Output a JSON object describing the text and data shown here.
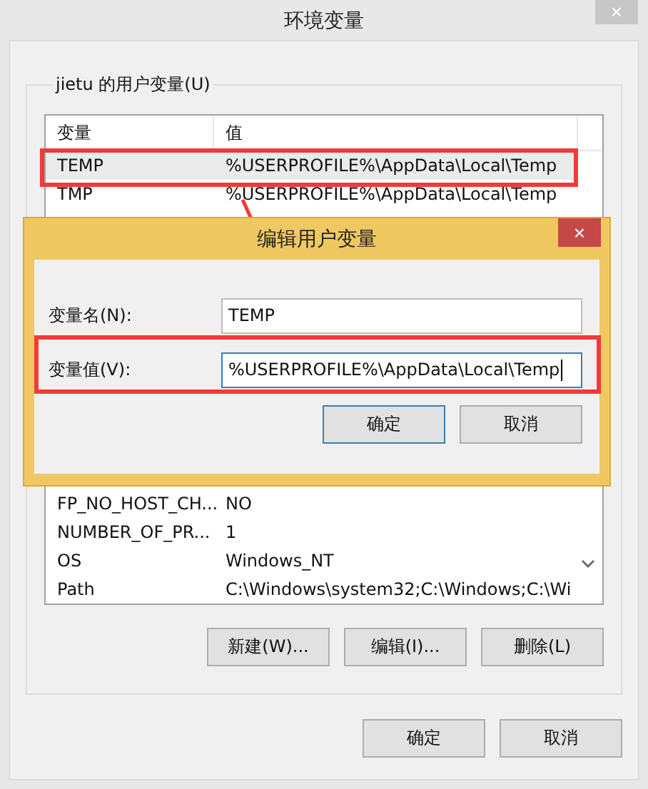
{
  "window": {
    "title": "环境变量",
    "close": "×"
  },
  "user_vars": {
    "label": "jietu 的用户变量(U)",
    "columns": [
      "变量",
      "值"
    ],
    "rows": [
      {
        "name": "TEMP",
        "value": "%USERPROFILE%\\AppData\\Local\\Temp",
        "selected": true
      },
      {
        "name": "TMP",
        "value": "%USERPROFILE%\\AppData\\Local\\Temp",
        "selected": false
      },
      {
        "name": "FP_NO_HOST_CH...",
        "value": "NO",
        "selected": false
      },
      {
        "name": "NUMBER_OF_PR...",
        "value": "1",
        "selected": false
      },
      {
        "name": "OS",
        "value": "Windows_NT",
        "selected": false
      },
      {
        "name": "Path",
        "value": "C:\\Windows\\system32;C:\\Windows;C:\\Wi",
        "selected": false
      }
    ],
    "buttons": [
      "新建(W)...",
      "编辑(I)...",
      "删除(L)"
    ]
  },
  "footer_buttons": [
    "确定",
    "取消"
  ],
  "dialog": {
    "title": "编辑用户变量",
    "close": "×",
    "fields": [
      {
        "label": "变量名(N):",
        "value": "TEMP",
        "focused": false
      },
      {
        "label": "变量值(V):",
        "value": "%USERPROFILE%\\AppData\\Local\\Temp",
        "focused": true
      }
    ],
    "buttons": [
      {
        "label": "确定",
        "default": true
      },
      {
        "label": "取消",
        "default": false
      }
    ]
  }
}
